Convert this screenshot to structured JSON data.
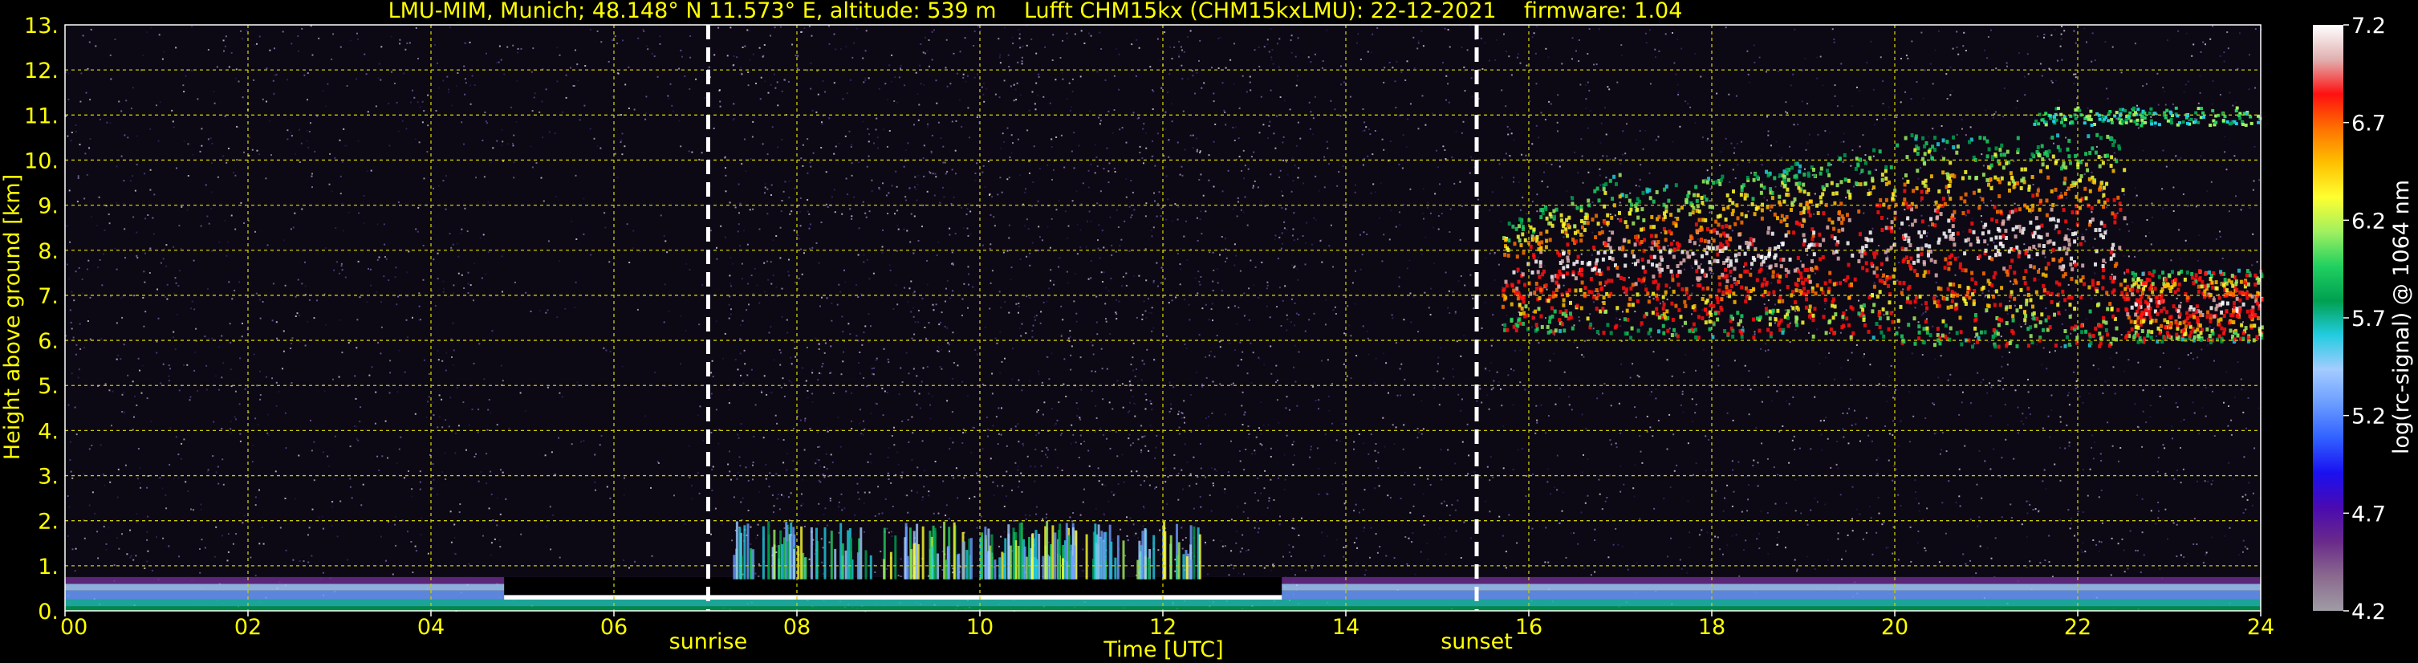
{
  "chart_data": {
    "type": "heatmap",
    "title": "LMU-MIM, Munich; 48.148° N 11.573° E, altitude: 539 m    Lufft CHM15kx (CHM15kxLMU): 22-12-2021    firmware: 1.04",
    "xlabel": "Time [UTC]",
    "ylabel": "Height above ground [km]",
    "x_ticks": [
      "00",
      "02",
      "04",
      "06",
      "08",
      "10",
      "12",
      "14",
      "16",
      "18",
      "20",
      "22",
      "24"
    ],
    "y_ticks": [
      "0.",
      "1.",
      "2.",
      "3.",
      "4.",
      "5.",
      "6.",
      "7.",
      "8.",
      "9.",
      "10.",
      "11.",
      "12.",
      "13."
    ],
    "xlim": [
      0,
      24
    ],
    "ylim": [
      0,
      13
    ],
    "grid": true,
    "colorbar": {
      "label": "log(rc-signal) @ 1064 nm",
      "range": [
        4.2,
        7.2
      ],
      "tick_labels": [
        "7.2",
        "6.7",
        "6.2",
        "5.7",
        "5.2",
        "4.7",
        "4.2"
      ],
      "tick_values": [
        7.2,
        6.7,
        6.2,
        5.7,
        5.2,
        4.7,
        4.2
      ]
    },
    "markers": [
      {
        "label": "sunrise",
        "x": 7.03
      },
      {
        "label": "sunset",
        "x": 15.43
      }
    ],
    "features": {
      "boundary_layer": {
        "x": [
          0,
          24
        ],
        "height_km": [
          0,
          0.8
        ]
      },
      "daytime_low_cloud_echoes": {
        "x": [
          7.3,
          12.5
        ],
        "height_km": [
          0.5,
          2.0
        ]
      },
      "cirrus_cloud": {
        "x": [
          15.7,
          24
        ],
        "height_km": [
          5.7,
          11.2
        ]
      }
    }
  },
  "colors": {
    "axis_text": "#ffff00",
    "grid": "#cccc00",
    "background": "#000000",
    "colormap": [
      "#a09ca4",
      "#8a6a8e",
      "#6a2a8a",
      "#4a0ab0",
      "#1a10f0",
      "#3060ff",
      "#6a9cff",
      "#a4ccff",
      "#22cce0",
      "#00a050",
      "#20d060",
      "#a0f060",
      "#ffff30",
      "#ffc000",
      "#ff7000",
      "#ff1010",
      "#e0b0b0",
      "#ffffff"
    ]
  }
}
